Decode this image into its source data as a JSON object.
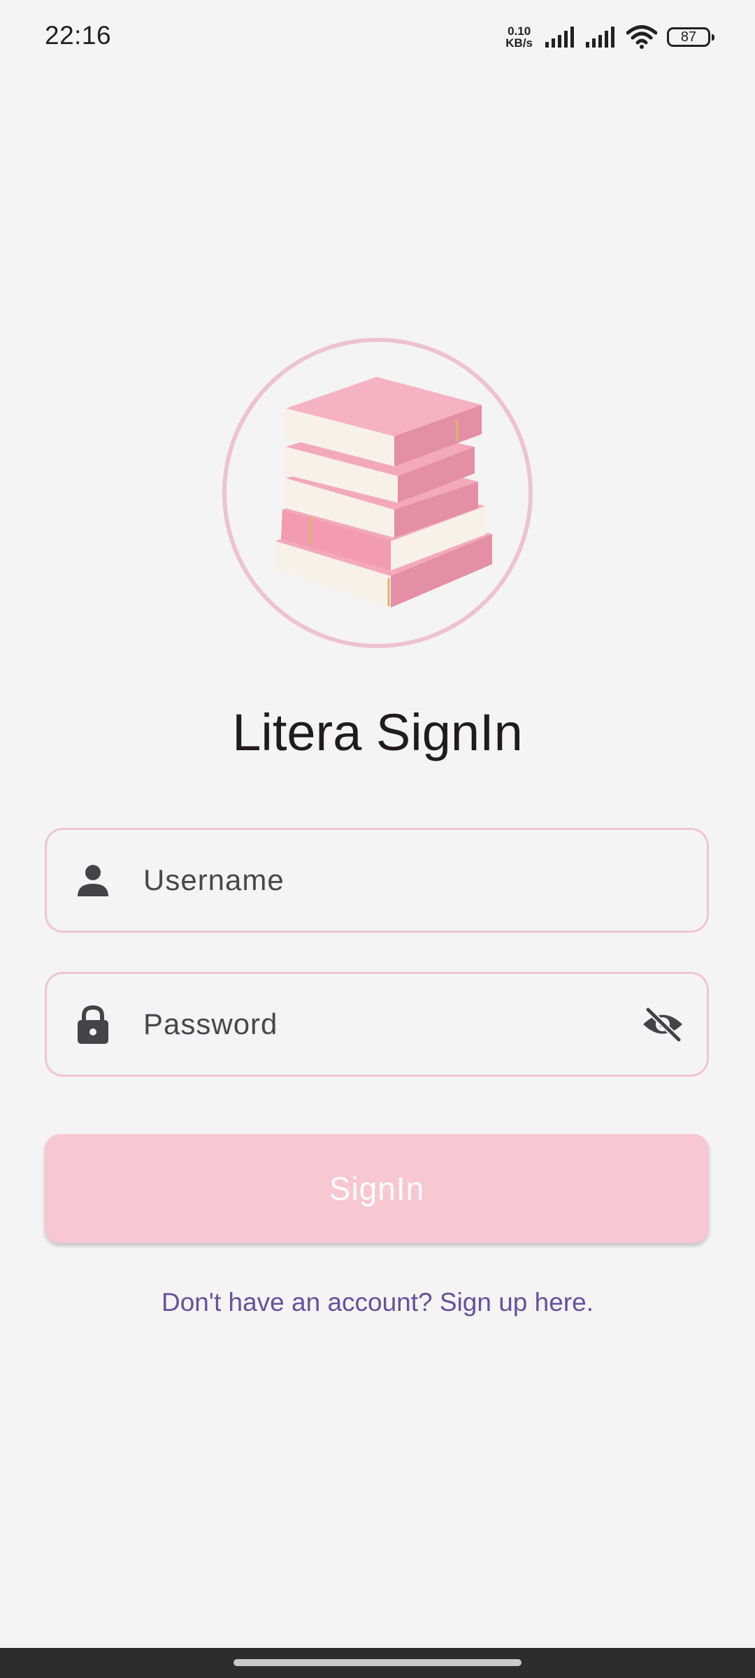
{
  "status_bar": {
    "time": "22:16",
    "net_speed_value": "0.10",
    "net_speed_unit": "KB/s",
    "battery": "87",
    "icons": [
      "signal-icon",
      "signal-icon",
      "wifi-icon",
      "battery-icon"
    ]
  },
  "logo": {
    "icon": "book-stack-icon",
    "colors": {
      "ring": "#eec3d0",
      "cover": "#f3a9ba",
      "pages": "#f7f1e8"
    }
  },
  "title": "Litera SignIn",
  "form": {
    "username": {
      "placeholder": "Username",
      "value": "",
      "icon": "person-icon"
    },
    "password": {
      "placeholder": "Password",
      "value": "",
      "icon": "lock-icon",
      "toggle_icon": "eye-off-icon"
    },
    "submit_label": "SignIn"
  },
  "signup_link": "Don't have an account? Sign up here.",
  "colors": {
    "background": "#f4f4f4",
    "field_border": "#f1c4d2",
    "button_bg": "#f7c7d2",
    "button_text": "#ffffff",
    "link": "#68509c",
    "title": "#1f1b1e"
  }
}
